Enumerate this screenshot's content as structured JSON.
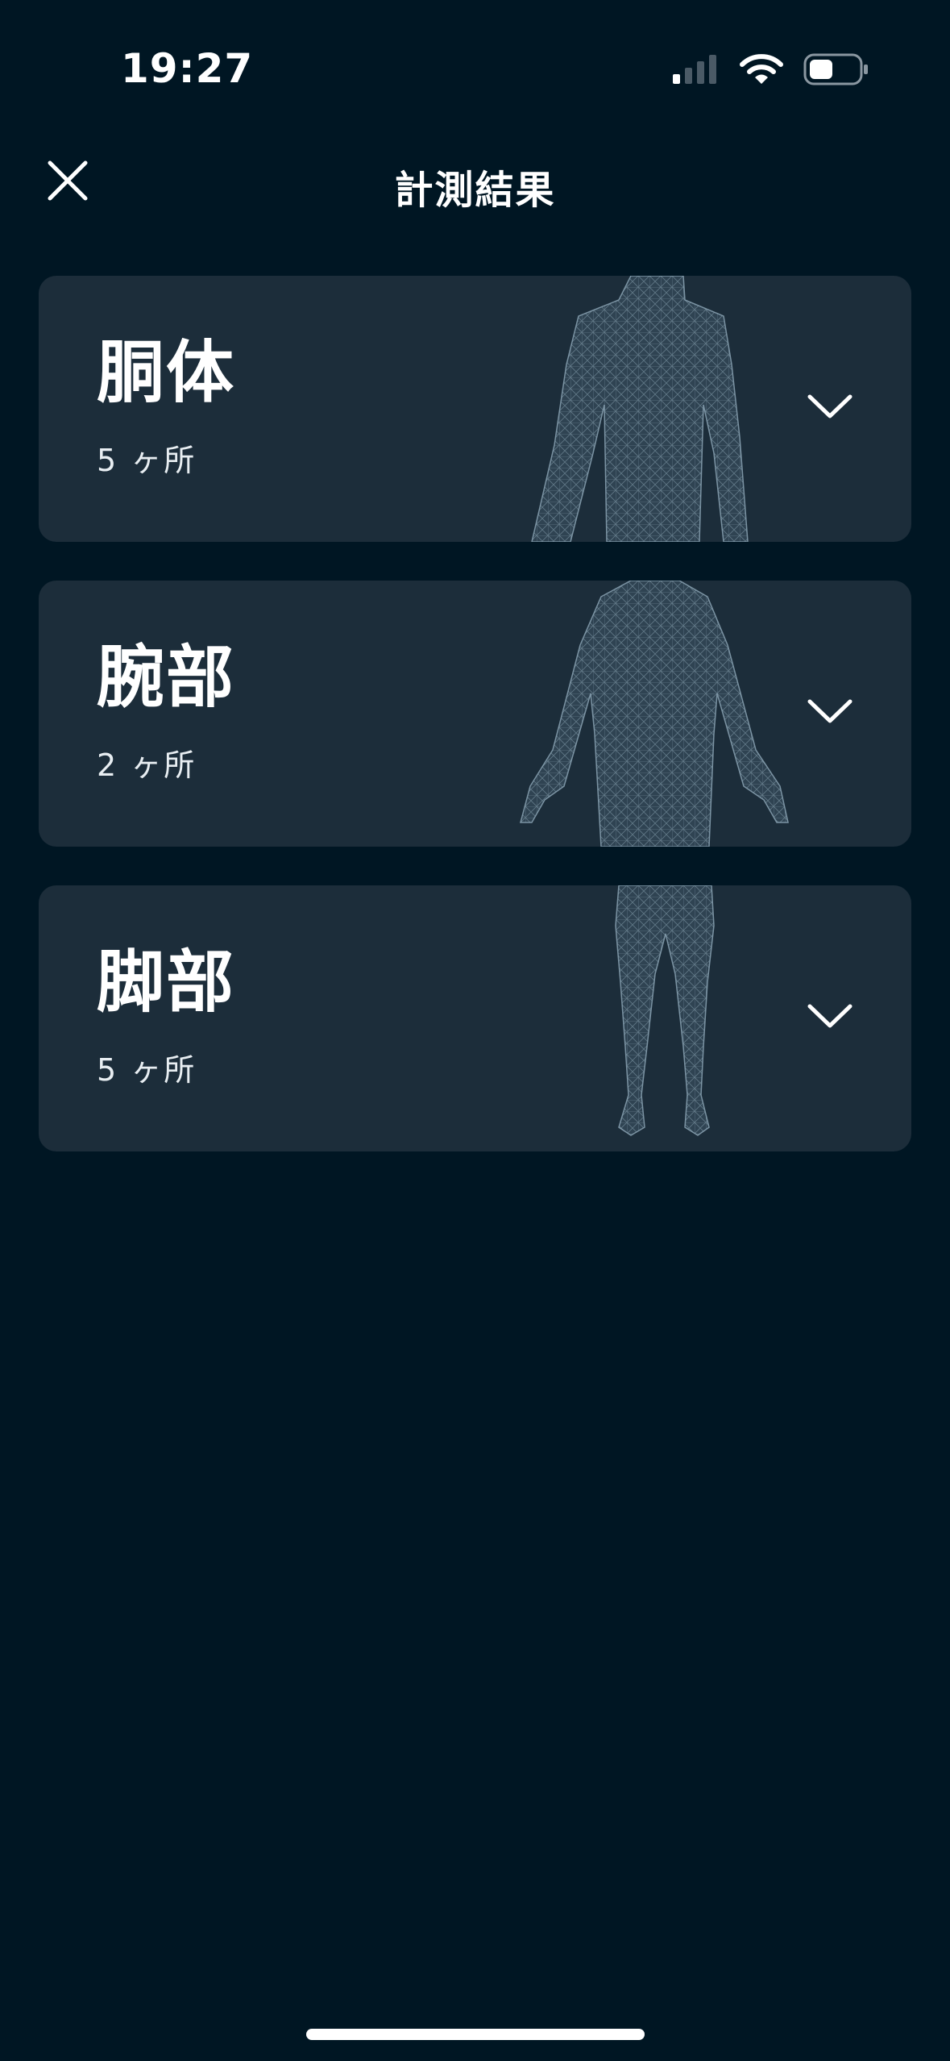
{
  "status": {
    "time": "19:27"
  },
  "nav": {
    "title": "計測結果"
  },
  "cards": [
    {
      "title": "胴体",
      "count": "5 ヶ所"
    },
    {
      "title": "腕部",
      "count": "2 ヶ所"
    },
    {
      "title": "脚部",
      "count": "5 ヶ所"
    }
  ],
  "colors": {
    "background": "#001623",
    "card": "#1c2d3a",
    "mesh": "#7b93a3"
  }
}
